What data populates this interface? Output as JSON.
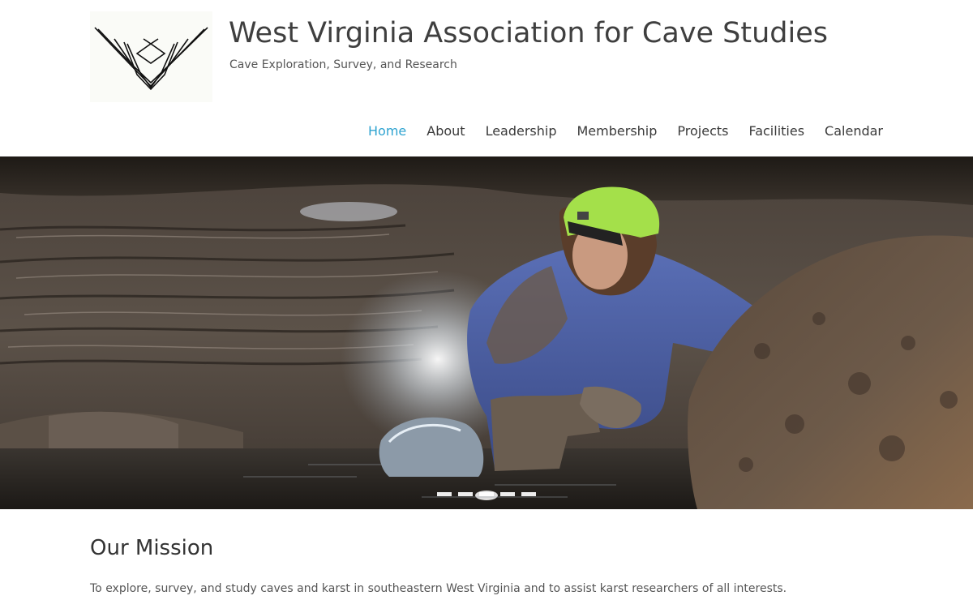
{
  "site": {
    "title": "West Virginia Association for Cave Studies",
    "tagline": "Cave Exploration, Survey, and Research",
    "logo_icon": "wvacs-logo"
  },
  "nav": {
    "items": [
      {
        "label": "Home",
        "active": true
      },
      {
        "label": "About",
        "active": false
      },
      {
        "label": "Leadership",
        "active": false
      },
      {
        "label": "Membership",
        "active": false
      },
      {
        "label": "Projects",
        "active": false
      },
      {
        "label": "Facilities",
        "active": false
      },
      {
        "label": "Calendar",
        "active": false
      }
    ],
    "active_color": "#2ea3d0"
  },
  "slider": {
    "slide_count": 5,
    "current_slide": 1,
    "image_subject": "caver-in-water-passage"
  },
  "mission": {
    "heading": "Our Mission",
    "text": "To explore, survey, and study caves and karst in southeastern West Virginia and to assist karst researchers of all interests."
  }
}
